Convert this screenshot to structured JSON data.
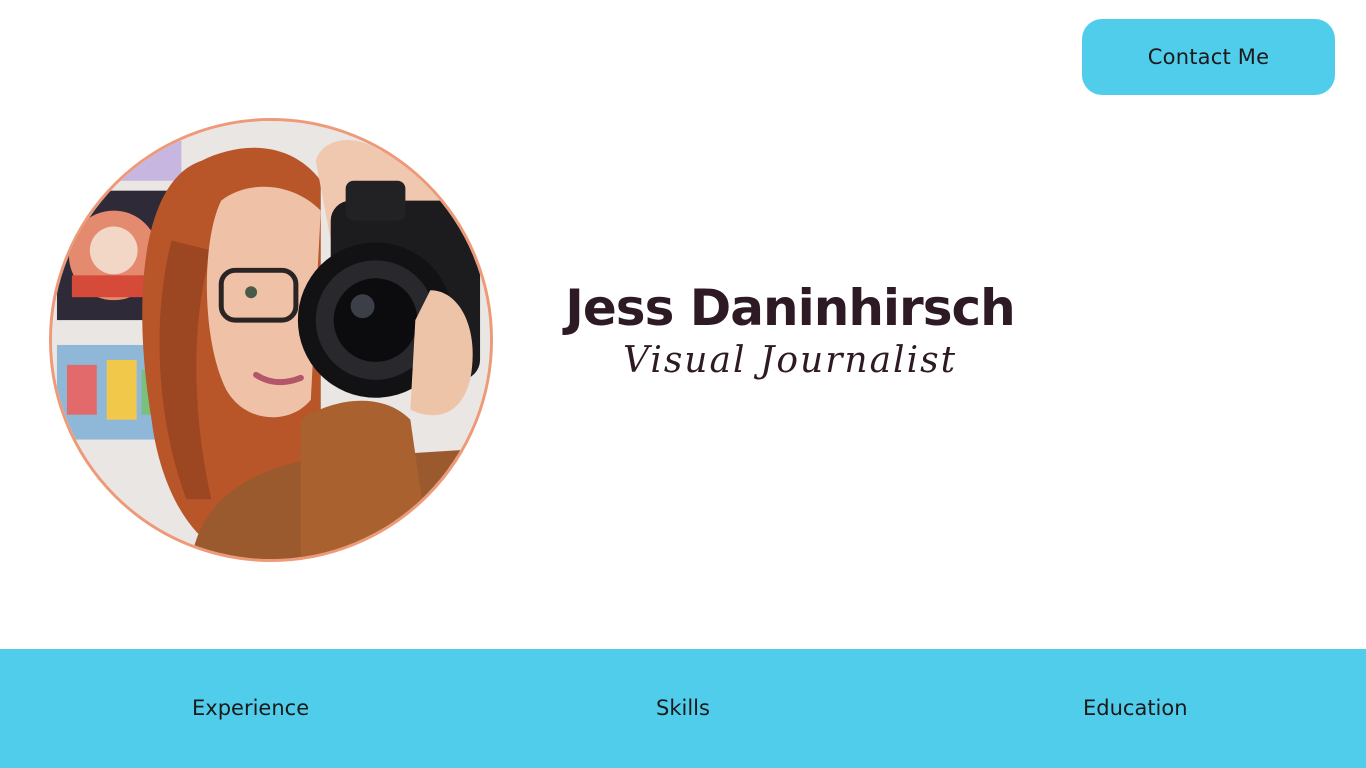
{
  "header": {
    "contact_label": "Contact Me"
  },
  "hero": {
    "name": "Jess Daninhirsch",
    "title": "Visual Journalist",
    "portrait_icon": "portrait-photo"
  },
  "nav": {
    "items": [
      {
        "label": "Experience"
      },
      {
        "label": "Skills"
      },
      {
        "label": "Education"
      }
    ]
  },
  "colors": {
    "accent": "#51cdec",
    "text_dark": "#2e1a24",
    "portrait_border": "#ee9a78"
  }
}
